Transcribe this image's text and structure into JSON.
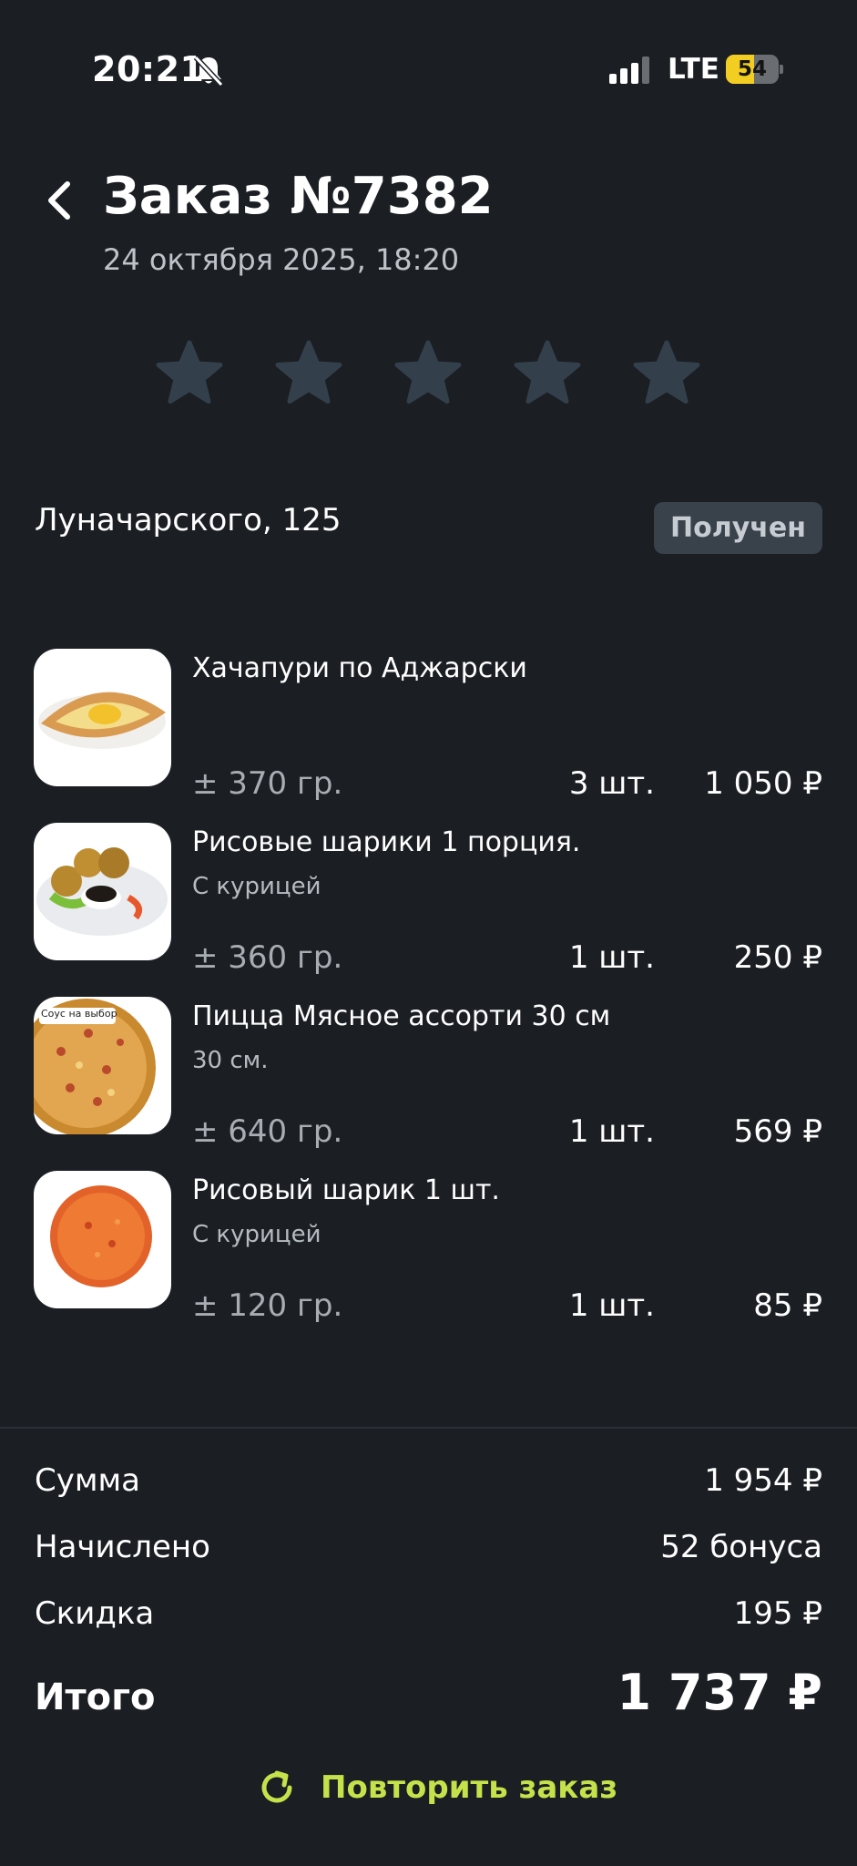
{
  "status_bar": {
    "time": "20:21",
    "network": "LTE",
    "battery": "54",
    "battery_level": 0.54,
    "icons": [
      "bell-muted-icon",
      "signal-icon"
    ]
  },
  "header": {
    "title": "Заказ №7382",
    "date": "24 октября 2025, 18:20",
    "back_icon": "chevron-left-icon"
  },
  "rating": {
    "stars": 5,
    "selected": 0,
    "star_color": "#33404c"
  },
  "order": {
    "address": "Луначарского, 125",
    "status": "Получен"
  },
  "items": [
    {
      "name": "Хачапури по Аджарски",
      "modifier": "",
      "weight": "± 370 гр.",
      "qty": "3 шт.",
      "price": "1 050 ₽",
      "image": "khachapuri-image"
    },
    {
      "name": "Рисовые шарики 1 порция.",
      "modifier": "С курицей",
      "weight": "± 360 гр.",
      "qty": "1 шт.",
      "price": "250 ₽",
      "image": "rice-balls-image"
    },
    {
      "name": "Пицца Мясное ассорти 30 см",
      "modifier": "30 см.",
      "weight": "± 640 гр.",
      "qty": "1 шт.",
      "price": "569 ₽",
      "image": "pizza-image",
      "image_caption": "Соус на выбор"
    },
    {
      "name": "Рисовый шарик 1 шт.",
      "modifier": "С курицей",
      "weight": "± 120 гр.",
      "qty": "1 шт.",
      "price": "85 ₽",
      "image": "rice-ball-image"
    }
  ],
  "summary": {
    "sum_label": "Сумма",
    "sum_value": "1 954 ₽",
    "bonus_label": "Начислено",
    "bonus_value": "52 бонуса",
    "discount_label": "Скидка",
    "discount_value": "195 ₽",
    "total_label": "Итого",
    "total_value": "1 737 ₽"
  },
  "repeat_button": {
    "label": "Повторить заказ",
    "icon": "refresh-icon",
    "color": "#c6e24a"
  },
  "colors": {
    "background": "#1b1e23",
    "badge_bg": "#39414a",
    "accent": "#c6e24a"
  }
}
